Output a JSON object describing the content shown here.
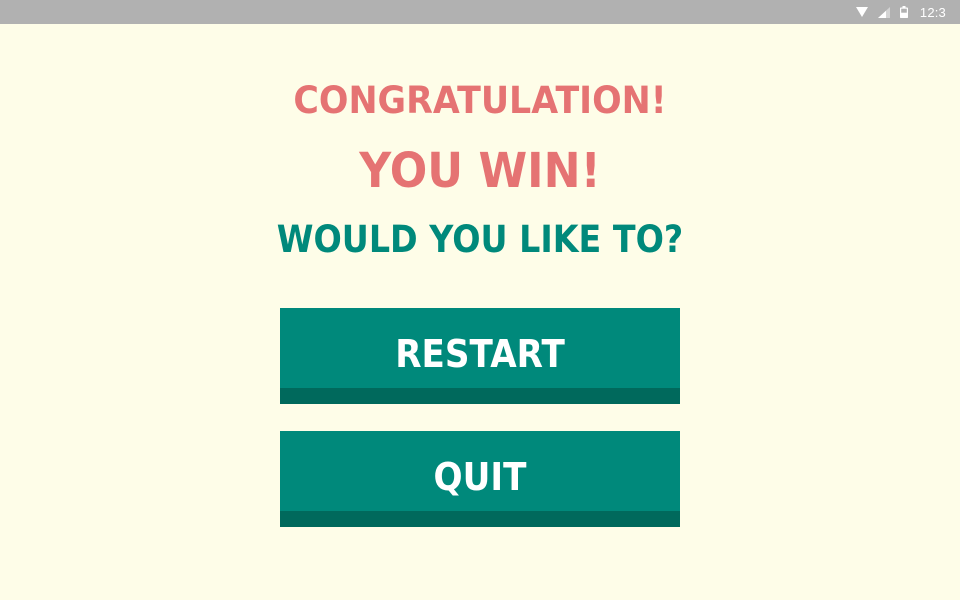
{
  "status_bar": {
    "time": "12:3",
    "icons": [
      "wifi-icon",
      "signal-icon",
      "battery-icon"
    ]
  },
  "dialog": {
    "congrats": "CONGRATULATION!",
    "win": "YOU WIN!",
    "prompt": "WOULD YOU LIKE TO?",
    "buttons": {
      "restart": "RESTART",
      "quit": "QUIT"
    }
  },
  "colors": {
    "background": "#fefde8",
    "status_bar": "#b1b1b1",
    "accent_red": "#e57373",
    "accent_teal": "#00897b",
    "button_shade": "#00695c"
  }
}
